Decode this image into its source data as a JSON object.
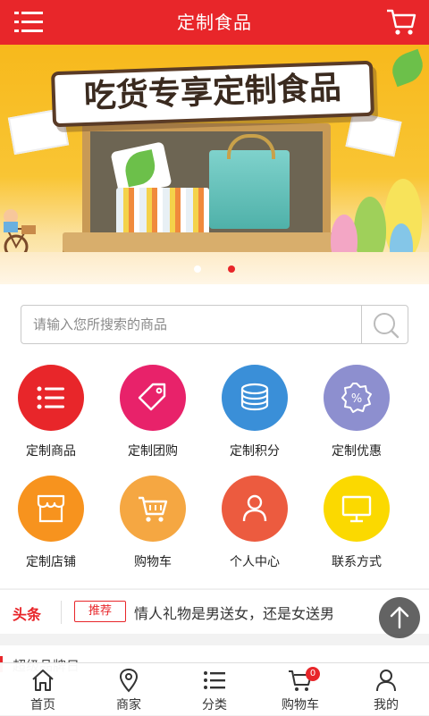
{
  "header": {
    "title": "定制食品"
  },
  "banner": {
    "headline": "吃货专享定制食品",
    "active_slide": 2,
    "slide_count": 2
  },
  "search": {
    "placeholder": "请输入您所搜索的商品",
    "value": ""
  },
  "grid": [
    {
      "label": "定制商品",
      "color": "#e8262a",
      "icon": "list-icon"
    },
    {
      "label": "定制团购",
      "color": "#e8226a",
      "icon": "tag-icon"
    },
    {
      "label": "定制积分",
      "color": "#3a8fd8",
      "icon": "coins-icon"
    },
    {
      "label": "定制优惠",
      "color": "#8d8fcf",
      "icon": "discount-icon"
    },
    {
      "label": "定制店铺",
      "color": "#f7931e",
      "icon": "store-icon"
    },
    {
      "label": "购物车",
      "color": "#f5a742",
      "icon": "cart-icon"
    },
    {
      "label": "个人中心",
      "color": "#ec5b3f",
      "icon": "user-icon"
    },
    {
      "label": "联系方式",
      "color": "#fbd900",
      "icon": "monitor-icon"
    }
  ],
  "ticker": {
    "tag": "头条",
    "badge": "推荐",
    "news": "情人礼物是男送女，还是女送男"
  },
  "section": {
    "title": "超级品牌日"
  },
  "bottom_nav": [
    {
      "label": "首页",
      "icon": "home-icon"
    },
    {
      "label": "商家",
      "icon": "location-icon"
    },
    {
      "label": "分类",
      "icon": "category-icon"
    },
    {
      "label": "购物车",
      "icon": "cart-icon",
      "badge": "0"
    },
    {
      "label": "我的",
      "icon": "user-icon"
    }
  ],
  "colors": {
    "brand": "#e8262a",
    "background": "#f2f2f2"
  }
}
